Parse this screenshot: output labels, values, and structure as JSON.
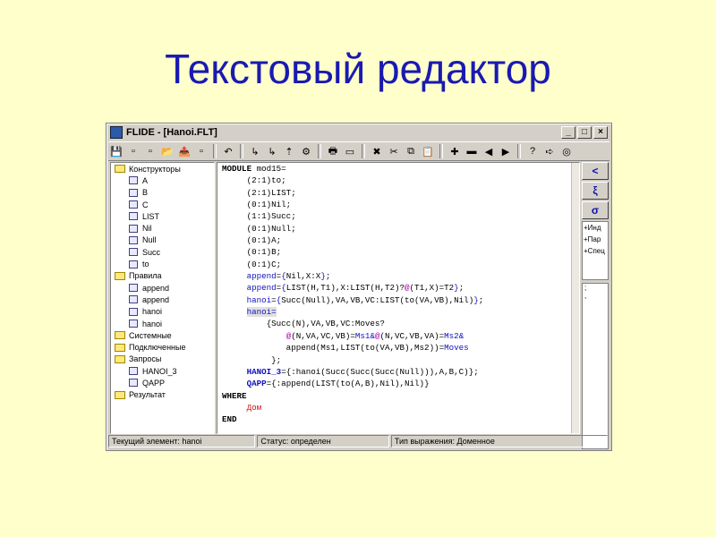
{
  "slide": {
    "title": "Текстовый редактор"
  },
  "window": {
    "title": "FLIDE - [Hanoi.FLT]",
    "minimize": "_",
    "maximize": "□",
    "close": "×"
  },
  "toolbar": {
    "icons": [
      "save-icon",
      "new-icon",
      "new2-icon",
      "open-icon",
      "export-icon",
      "print-setup-icon",
      "undo-icon",
      "run-icon",
      "step-icon",
      "up-icon",
      "tools-icon",
      "print-icon",
      "preview-icon",
      "delete-icon",
      "cut-icon",
      "copy-icon",
      "paste-icon",
      "add-icon",
      "remove-icon",
      "left-icon",
      "right-icon",
      "help-icon",
      "forward-icon",
      "eye-icon"
    ],
    "glyphs": [
      "💾",
      "▫",
      "▫",
      "📂",
      "📤",
      "▫",
      "↶",
      "↳",
      "↳",
      "⇡",
      "⚙",
      "🖶",
      "▭",
      "✖",
      "✂",
      "⧉",
      "📋",
      "✚",
      "▬",
      "◀",
      "▶",
      "?",
      "➪",
      "◎"
    ]
  },
  "tree": [
    {
      "type": "folder",
      "label": "Конструкторы"
    },
    {
      "type": "leaf",
      "label": "A"
    },
    {
      "type": "leaf",
      "label": "B"
    },
    {
      "type": "leaf",
      "label": "C"
    },
    {
      "type": "leaf",
      "label": "LIST"
    },
    {
      "type": "leaf",
      "label": "Nil"
    },
    {
      "type": "leaf",
      "label": "Null"
    },
    {
      "type": "leaf",
      "label": "Succ"
    },
    {
      "type": "leaf",
      "label": "to"
    },
    {
      "type": "folder",
      "label": "Правила"
    },
    {
      "type": "leaf",
      "label": "append"
    },
    {
      "type": "leaf",
      "label": "append"
    },
    {
      "type": "leaf",
      "label": "hanoi"
    },
    {
      "type": "leaf",
      "label": "hanoi"
    },
    {
      "type": "folder",
      "label": "Системные"
    },
    {
      "type": "folder",
      "label": "Подключенные"
    },
    {
      "type": "folder",
      "label": "Запросы"
    },
    {
      "type": "leaf",
      "label": "HANOI_3"
    },
    {
      "type": "leaf",
      "label": "QAPP"
    },
    {
      "type": "folder",
      "label": "Результат"
    }
  ],
  "code": [
    "MODULE mod15=",
    "     (2:1)to;",
    "     (2:1)LIST;",
    "     (0:1)Nil;",
    "     (1:1)Succ;",
    "     (0:1)Null;",
    "     (0:1)A;",
    "     (0:1)B;",
    "     (0:1)C;",
    "     append={Nil,X:X};",
    "     append={LIST(H,T1),X:LIST(H,T2)?@(T1,X)=T2};",
    "     hanoi={Succ(Null),VA,VB,VC:LIST(to(VA,VB),Nil)};",
    "     hanoi=",
    "         {Succ(N),VA,VB,VC:Moves?",
    "             @(N,VA,VC,VB)=Ms1&@(N,VC,VB,VA)=Ms2&",
    "             append(Ms1,LIST(to(VA,VB),Ms2))=Moves",
    "          };",
    "     HANOI_3={:hanoi(Succ(Succ(Succ(Null))),A,B,C)};",
    "     QAPP={:append(LIST(to(A,B),Nil),Nil)}",
    "WHERE",
    "     Дом",
    "END"
  ],
  "right_panel": {
    "buttons": [
      "<",
      "ξ",
      "σ"
    ],
    "list": [
      "+Инд",
      "+Пар",
      "+Спец"
    ],
    "list2": [
      ";",
      ","
    ]
  },
  "status": {
    "current": "Текущий элемент: hanoi",
    "state": "Статус: определен",
    "type": "Тип выражения: Доменное"
  }
}
